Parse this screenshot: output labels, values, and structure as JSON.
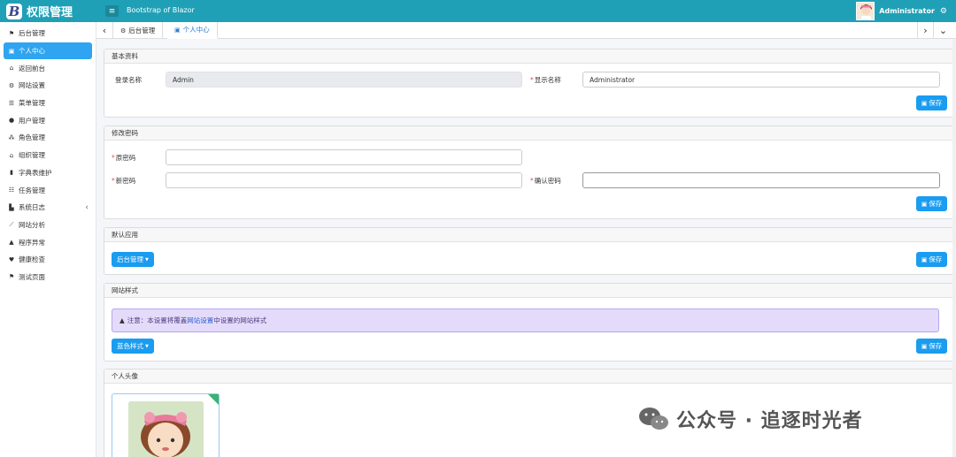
{
  "header": {
    "brand_logo": "B",
    "brand_title": "权限管理",
    "menu_icon": "hamburger-icon",
    "subtitle": "Bootstrap of Blazor",
    "user_name": "Administrator",
    "gear_icon": "gears-icon"
  },
  "sidebar": {
    "items": [
      {
        "label": "后台管理",
        "icon": "flag-icon"
      },
      {
        "label": "个人中心",
        "icon": "briefcase-icon",
        "active": true
      },
      {
        "label": "返回前台",
        "icon": "home-icon"
      },
      {
        "label": "网站设置",
        "icon": "gear-icon"
      },
      {
        "label": "菜单管理",
        "icon": "list-icon"
      },
      {
        "label": "用户管理",
        "icon": "user-cog-icon"
      },
      {
        "label": "角色管理",
        "icon": "users-icon"
      },
      {
        "label": "组织管理",
        "icon": "sitemap-icon"
      },
      {
        "label": "字典表维护",
        "icon": "book-icon"
      },
      {
        "label": "任务管理",
        "icon": "tasks-icon"
      },
      {
        "label": "系统日志",
        "icon": "chart-bar-icon",
        "arrow": "‹"
      },
      {
        "label": "网站分析",
        "icon": "chart-line-icon"
      },
      {
        "label": "程序异常",
        "icon": "warning-icon"
      },
      {
        "label": "健康检查",
        "icon": "heartbeat-icon"
      },
      {
        "label": "测试页面",
        "icon": "flag-icon"
      }
    ]
  },
  "tabs": {
    "prev": "‹",
    "next": "›",
    "dropdown": "⌄",
    "items": [
      {
        "label": "后台管理",
        "icon": "gear-icon"
      },
      {
        "label": "个人中心",
        "icon": "briefcase-icon",
        "active": true
      }
    ]
  },
  "basic_info": {
    "title": "基本资料",
    "login_label": "登录名称",
    "login_value": "Admin",
    "display_label": "显示名称",
    "display_value": "Administrator",
    "save_label": "保存"
  },
  "password": {
    "title": "修改密码",
    "old_label": "原密码",
    "new_label": "新密码",
    "confirm_label": "确认密码",
    "save_label": "保存"
  },
  "default_app": {
    "title": "默认应用",
    "selected": "后台管理",
    "save_label": "保存"
  },
  "site_style": {
    "title": "网站样式",
    "alert_prefix": "注意：本设置将覆盖",
    "alert_link": "网站设置",
    "alert_suffix": "中设置的网站样式",
    "selected": "蓝色样式",
    "save_label": "保存"
  },
  "avatar": {
    "title": "个人头像"
  },
  "watermark": {
    "text": "公众号 · 追逐时光者"
  },
  "colors": {
    "header": "#20a0b6",
    "primary": "#1a9cf0",
    "active_nav": "#2fa4f0",
    "alert_bg": "#e4dbfb"
  }
}
